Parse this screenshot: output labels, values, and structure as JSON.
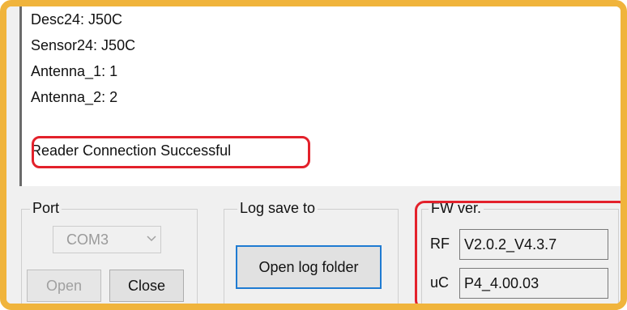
{
  "log": {
    "lines": [
      "Desc24: J50C",
      "Sensor24: J50C",
      "Antenna_1: 1",
      "Antenna_2: 2"
    ],
    "status": "Reader Connection Successful"
  },
  "port": {
    "title": "Port",
    "selected": "COM3",
    "open_label": "Open",
    "close_label": "Close"
  },
  "log_save": {
    "title": "Log save to",
    "button_label": "Open log folder"
  },
  "fw": {
    "title": "FW ver.",
    "rf_label": "RF",
    "rf_value": "V2.0.2_V4.3.7",
    "uc_label": "uC",
    "uc_value": "P4_4.00.03"
  },
  "colors": {
    "frame": "#f0b43c",
    "highlight": "#e3212b",
    "focus": "#1f7bd2"
  }
}
